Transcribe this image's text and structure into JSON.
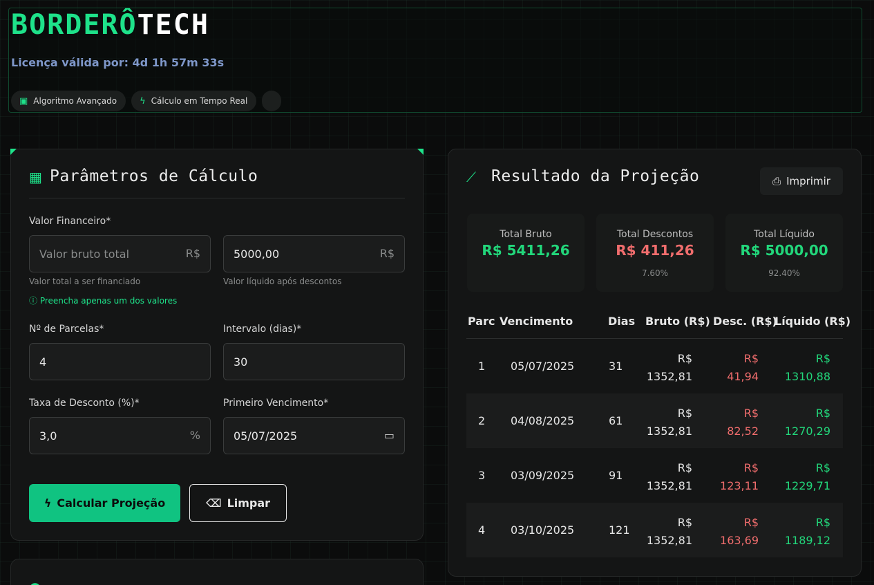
{
  "header": {
    "logo_part1": "BORDERÔ",
    "logo_part2": "TECH",
    "license": "Licença válida por: 4d 1h 57m 33s",
    "chips": [
      {
        "label": "Algoritmo Avançado",
        "icon": "chip-icon"
      },
      {
        "label": "Cálculo em Tempo Real",
        "icon": "bolt-icon"
      }
    ]
  },
  "params": {
    "title": "Parâmetros de Cálculo",
    "valor_label": "Valor Financeiro*",
    "bruto_placeholder": "Valor bruto total",
    "bruto_suffix": "R$",
    "liquido_value": "5000,00",
    "liquido_suffix": "R$",
    "bruto_hint": "Valor total a ser financiado",
    "liquido_hint": "Valor líquido após descontos",
    "note": "Preencha apenas um dos valores",
    "parcelas_label": "Nº de Parcelas*",
    "parcelas_value": "4",
    "intervalo_label": "Intervalo (dias)*",
    "intervalo_value": "30",
    "taxa_label": "Taxa de Desconto (%)*",
    "taxa_value": "3,0",
    "taxa_suffix": "%",
    "vencimento_label": "Primeiro Vencimento*",
    "vencimento_value": "05/07/2025",
    "calc_button": "Calcular Projeção",
    "clear_button": "Limpar"
  },
  "result": {
    "title": "Resultado da Projeção",
    "print_button": "Imprimir",
    "stats": [
      {
        "title": "Total Bruto",
        "value": "R$ 5411,26",
        "pct": ""
      },
      {
        "title": "Total Descontos",
        "value": "R$ 411,26",
        "pct": "7.60%"
      },
      {
        "title": "Total Líquido",
        "value": "R$ 5000,00",
        "pct": "92.40%"
      }
    ],
    "columns": [
      "Parc",
      "Vencimento",
      "Dias",
      "Bruto (R$)",
      "Desc. (R$)",
      "Líquido (R$)"
    ],
    "rows": [
      {
        "parc": "1",
        "venc": "05/07/2025",
        "dias": "31",
        "bruto": "R$ 1352,81",
        "desc": "R$ 41,94",
        "liq": "R$ 1310,88"
      },
      {
        "parc": "2",
        "venc": "04/08/2025",
        "dias": "61",
        "bruto": "R$ 1352,81",
        "desc": "R$ 82,52",
        "liq": "R$ 1270,29"
      },
      {
        "parc": "3",
        "venc": "03/09/2025",
        "dias": "91",
        "bruto": "R$ 1352,81",
        "desc": "R$ 123,11",
        "liq": "R$ 1229,71"
      },
      {
        "parc": "4",
        "venc": "03/10/2025",
        "dias": "121",
        "bruto": "R$ 1352,81",
        "desc": "R$ 163,69",
        "liq": "R$ 1189,12"
      }
    ]
  },
  "colors": {
    "accent": "#1ee28a",
    "red": "#f06d6d",
    "green": "#22d77b",
    "brand_blue": "#7e97c9"
  }
}
